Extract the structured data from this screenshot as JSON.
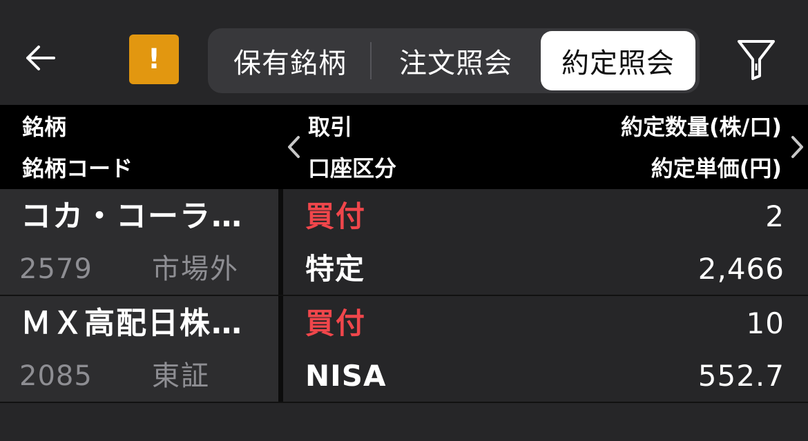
{
  "colors": {
    "background": "#262628",
    "header_bg": "#000000",
    "accent_warning": "#e29710",
    "buy_red": "#f0464b",
    "muted_text": "#8e8e93"
  },
  "toolbar": {
    "back_icon": "arrow-left-icon",
    "alert_label": "!",
    "filter_icon": "filter-funnel-icon",
    "tabs": [
      {
        "label": "保有銘柄",
        "selected": false
      },
      {
        "label": "注文照会",
        "selected": false
      },
      {
        "label": "約定照会",
        "selected": true
      }
    ]
  },
  "table": {
    "headers": {
      "col1_row1": "銘柄",
      "col1_row2": "銘柄コード",
      "col2_row1": "取引",
      "col2_row2": "口座区分",
      "col3_row1": "約定数量(株/口)",
      "col3_row2": "約定単価(円)"
    },
    "rows": [
      {
        "name": "コカ・コーラ…",
        "code": "2579",
        "market": "市場外",
        "trade": "買付",
        "account": "特定",
        "quantity": "2",
        "price": "2,466"
      },
      {
        "name": "ＭＸ高配日株…",
        "code": "2085",
        "market": "東証",
        "trade": "買付",
        "account": "NISA",
        "quantity": "10",
        "price": "552.7"
      }
    ]
  }
}
